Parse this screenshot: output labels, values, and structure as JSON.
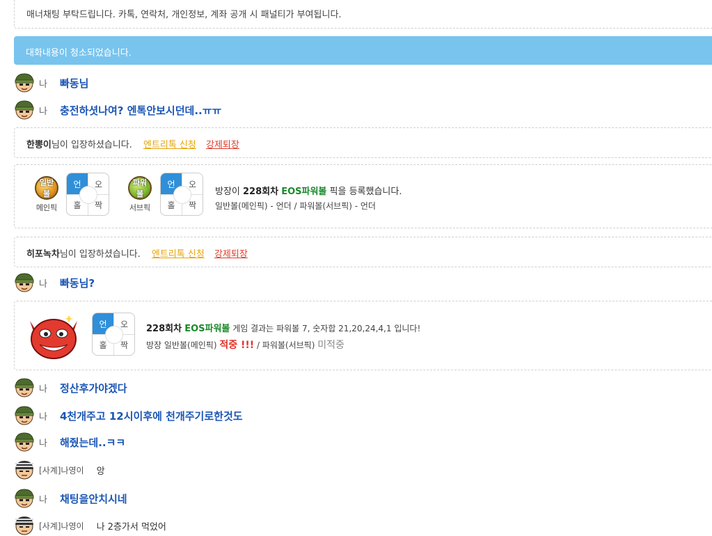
{
  "manner_notice": "매너채팅 부탁드립니다. 카톡, 연락처, 개인정보, 계좌 공개 시 패널티가 부여됩니다.",
  "cleared_notice": "대화내용이 청소되었습니다.",
  "me_label": "나",
  "msgs": {
    "m1": "빠동님",
    "m2": "충전하셧나여? 엔톡안보시던데..ㅠㅠ",
    "m3": "빠동님?",
    "m4": "정산후가야겠다",
    "m5": "4천개주고 12시이후에 천개주기로한것도",
    "m6": "해줬는데..ㅋㅋ",
    "m7": "채팅을안치시네"
  },
  "others": {
    "o1_name": "[사계]나영이",
    "o1_text": "앙",
    "o2_name": "[사계]나영이",
    "o2_text": "나 2층가서 먹었어"
  },
  "enter1": {
    "name": "한뽕이",
    "suffix": "님이 입장하셨습니다.",
    "req": "엔트리톡 신청",
    "kick": "강제퇴장"
  },
  "enter2": {
    "name": "히포녹차",
    "suffix": "님이 입장하셨습니다.",
    "req": "엔트리톡 신청",
    "kick": "강제퇴장"
  },
  "pick": {
    "ball1": "일반볼",
    "ball1_caption": "메인픽",
    "ball2": "파워볼",
    "ball2_caption": "서브픽",
    "grid_tl": "언",
    "grid_tr": "오",
    "grid_bl": "홀",
    "grid_br": "짝",
    "pre": "방장이 ",
    "round": "228회차",
    "game": "EOS파워볼",
    "post": " 픽을 등록했습니다.",
    "detail": "일반볼(메인픽) - 언더 / 파워볼(서브픽) - 언더"
  },
  "result": {
    "round": "228회차",
    "game": "EOS파워볼",
    "text": " 게임 결과는 파워볼 7, 숫자합 21,20,24,4,1 입니다!",
    "line2_pre": "방장 일반볼(메인픽) ",
    "hit": "적중 !!!",
    "line2_mid": " / 파워볼(서브픽) ",
    "miss": "미적중"
  },
  "colors": {
    "accent": "#78c4ee",
    "me_text": "#1b56b5",
    "green": "#1a8a2a",
    "red": "#e0332a",
    "selected": "#2f8fd8"
  }
}
